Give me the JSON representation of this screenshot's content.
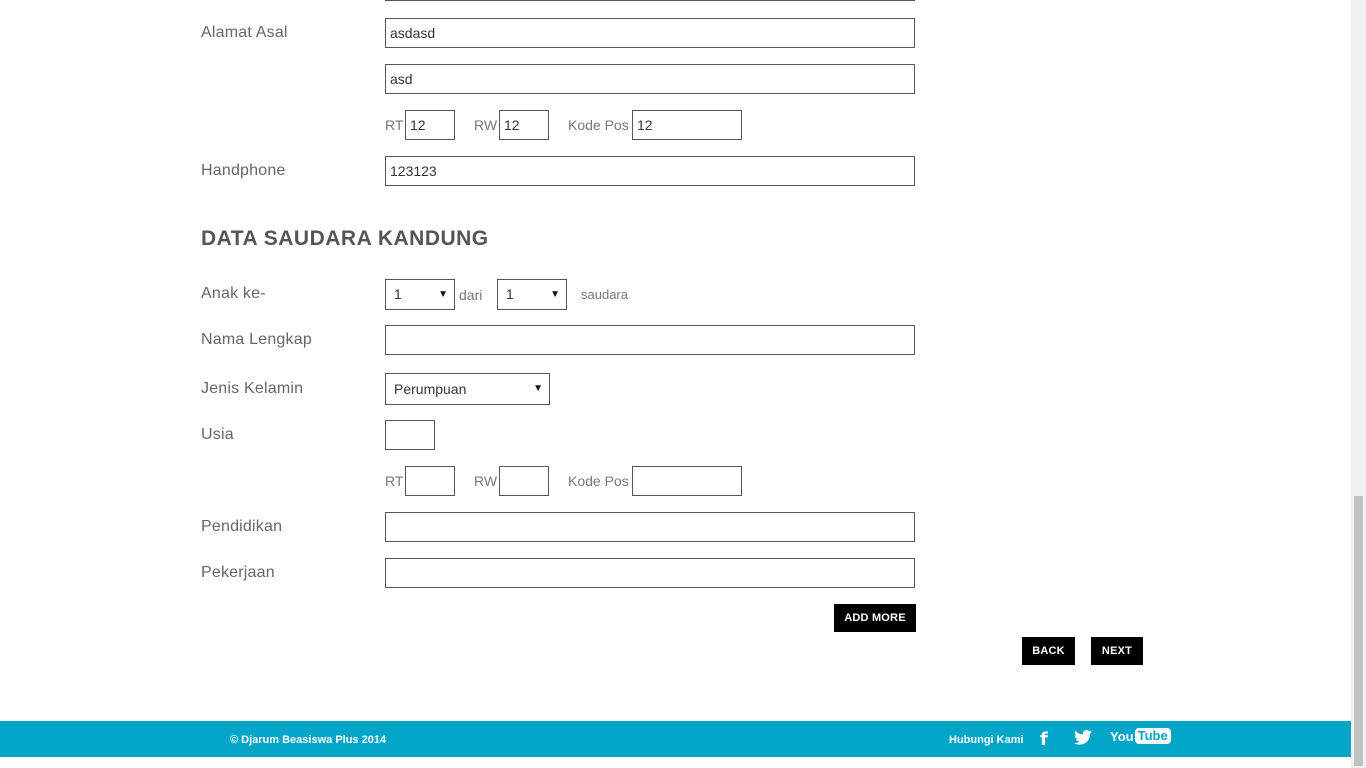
{
  "alamat_asal": {
    "label": "Alamat Asal",
    "line1": "asdasd",
    "line2": "asd",
    "rt_label": "RT",
    "rt_value": "12",
    "rw_label": "RW",
    "rw_value": "12",
    "kodepos_label": "Kode Pos",
    "kodepos_value": "12"
  },
  "handphone": {
    "label": "Handphone",
    "value": "123123"
  },
  "section": {
    "title": "DATA SAUDARA KANDUNG"
  },
  "anak_ke": {
    "label": "Anak ke-",
    "value": "1",
    "dari_label": "dari",
    "total_value": "1",
    "saudara_label": "saudara"
  },
  "nama_lengkap": {
    "label": "Nama Lengkap",
    "value": ""
  },
  "jenis_kelamin": {
    "label": "Jenis Kelamin",
    "value": "Perumpuan"
  },
  "usia": {
    "label": "Usia",
    "value": ""
  },
  "alamat_saudara": {
    "rt_label": "RT",
    "rt_value": "",
    "rw_label": "RW",
    "rw_value": "",
    "kodepos_label": "Kode Pos",
    "kodepos_value": ""
  },
  "pendidikan": {
    "label": "Pendidikan",
    "value": ""
  },
  "pekerjaan": {
    "label": "Pekerjaan",
    "value": ""
  },
  "buttons": {
    "add_more": "ADD MORE",
    "back": "BACK",
    "next": "NEXT"
  },
  "footer": {
    "copyright": "© Djarum Beasiswa Plus 2014",
    "contact": "Hubungi Kami",
    "youtube_you": "You",
    "youtube_tube": "Tube"
  },
  "colors": {
    "footer_bg": "#00a5c8",
    "button_bg": "#000000"
  },
  "icons": {
    "facebook": "facebook-icon",
    "twitter": "twitter-icon",
    "youtube": "youtube-icon",
    "caret": "chevron-down-icon"
  }
}
